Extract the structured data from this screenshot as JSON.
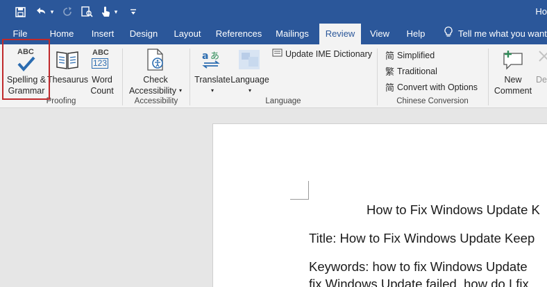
{
  "title_bar": {
    "title_partial": "Ho",
    "qat": {
      "save_icon": "save-icon",
      "undo_icon": "undo-icon",
      "redo_icon": "redo-icon",
      "touch_icon": "touch-mode-icon",
      "customize_icon": "customize-qat-icon"
    }
  },
  "tabs": [
    "File",
    "Home",
    "Insert",
    "Design",
    "Layout",
    "References",
    "Mailings",
    "Review",
    "View",
    "Help"
  ],
  "active_tab": "Review",
  "tell_me": "Tell me what you want",
  "ribbon": {
    "proofing": {
      "spelling_line1": "Spelling &",
      "spelling_line2": "Grammar",
      "spelling_icon_text": "ABC",
      "thesaurus": "Thesaurus",
      "word_count_line1": "Word",
      "word_count_line2": "Count",
      "word_count_icon_top": "ABC",
      "word_count_icon_bottom": "123",
      "group": "Proofing"
    },
    "accessibility": {
      "check_line1": "Check",
      "check_line2": "Accessibility",
      "group": "Accessibility"
    },
    "language": {
      "translate": "Translate",
      "language": "Language",
      "update_ime": "Update IME Dictionary",
      "group": "Language"
    },
    "chinese": {
      "simplified": "Simplified",
      "traditional": "Traditional",
      "convert": "Convert with Options",
      "group": "Chinese Conversion"
    },
    "comments": {
      "new_line1": "New",
      "new_line2": "Comment",
      "delete_partial": "De"
    }
  },
  "document": {
    "heading": "How to Fix Windows Update K",
    "title_line": "Title: How to Fix Windows Update Keep",
    "keywords_line": "Keywords: how to fix Windows Update",
    "keywords_line2": "fix Windows Update failed, how do I fix"
  },
  "colors": {
    "brand": "#2b579a",
    "highlight": "#c0292b",
    "spell_check_blue": "#2b6cb0"
  }
}
